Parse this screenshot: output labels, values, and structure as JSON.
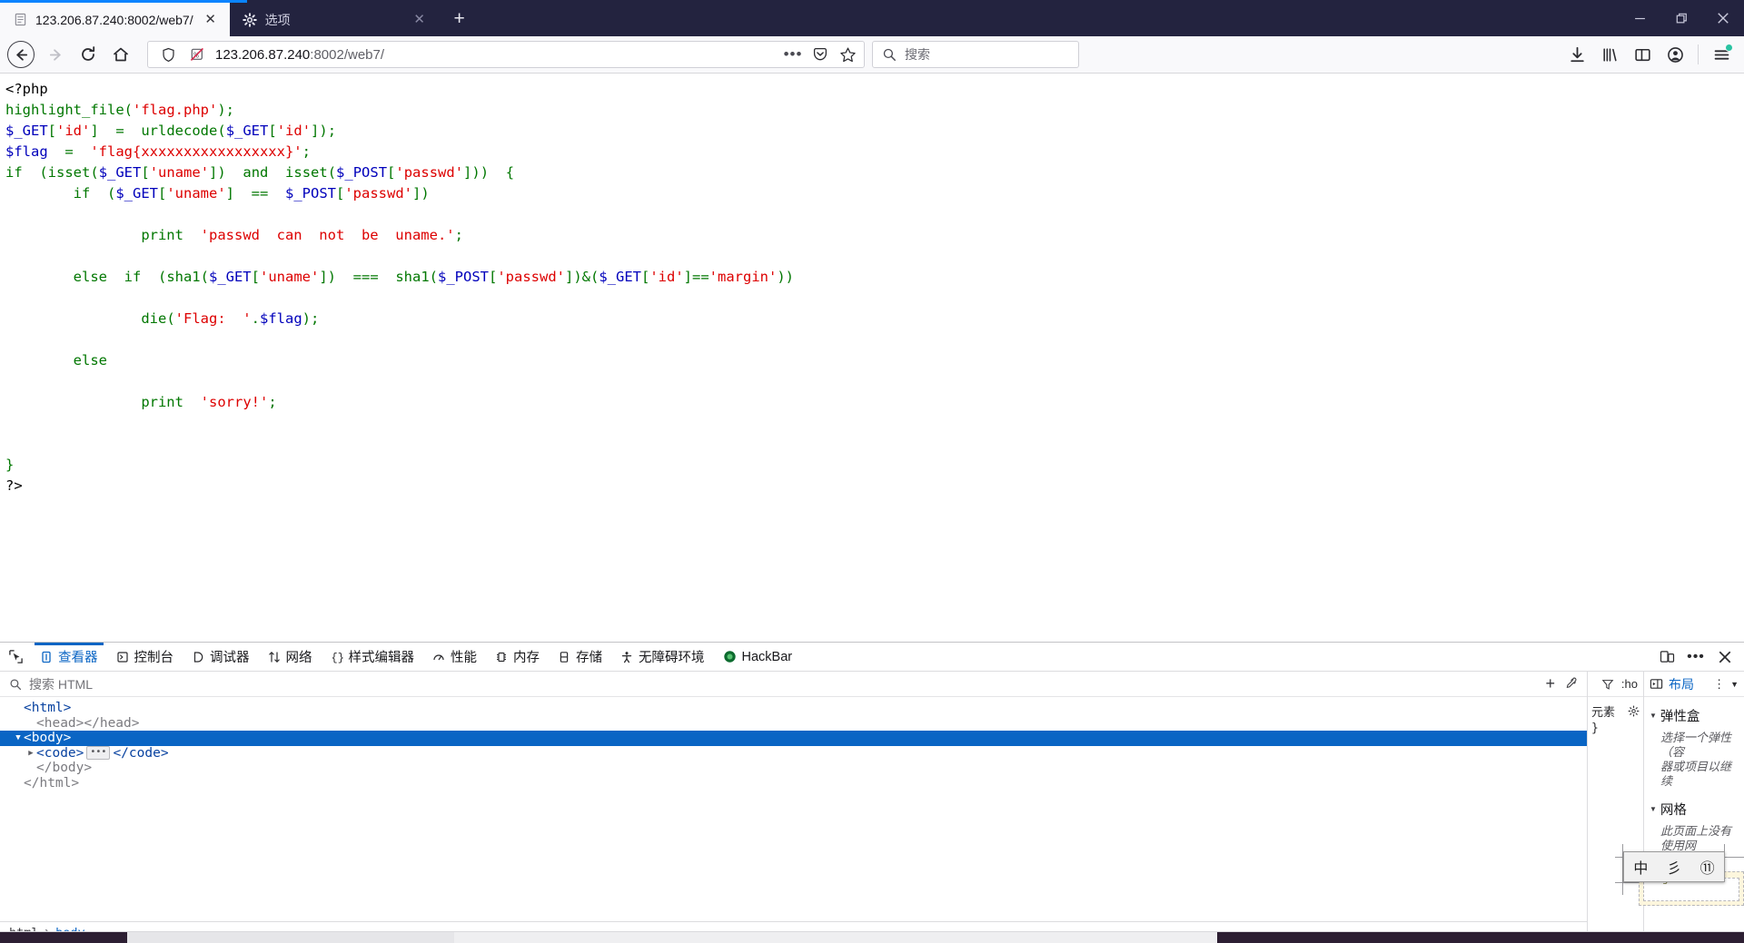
{
  "window": {
    "controls": {
      "minimize": "—",
      "maximize": "❐",
      "close": "✕"
    }
  },
  "tabs": [
    {
      "title": "123.206.87.240:8002/web7/",
      "favicon": "page-icon",
      "close_label": "✕",
      "active": true
    },
    {
      "title": "选项",
      "favicon": "gear-icon",
      "close_label": "✕",
      "active": false
    }
  ],
  "newtab_label": "+",
  "toolbar": {
    "back_label": "←",
    "forward_label": "→",
    "reload_label": "⟳",
    "home_label": "⌂",
    "url_host": "123.206.87.240",
    "url_path": ":8002/web7/",
    "shield_icon": "shield-icon",
    "tracking_blocked_icon": "tracking-protection-off-icon",
    "page_actions_label": "•••",
    "pocket_icon": "pocket-icon",
    "bookmark_icon": "star-icon",
    "search_placeholder": "搜索",
    "search_icon": "search-icon",
    "downloads_icon": "download-icon",
    "library_icon": "library-icon",
    "sidebar_icon": "sidebar-icon",
    "account_icon": "account-icon",
    "menu_icon": "hamburger-menu-icon"
  },
  "page": {
    "code_lines": [
      [
        {
          "t": "<?php",
          "c": "html"
        }
      ],
      [
        {
          "t": "highlight_file",
          "c": "def"
        },
        {
          "t": "(",
          "c": "kw"
        },
        {
          "t": "'flag.php'",
          "c": "str"
        },
        {
          "t": ");",
          "c": "kw"
        }
      ],
      [
        {
          "t": "$_GET",
          "c": "var"
        },
        {
          "t": "[",
          "c": "kw"
        },
        {
          "t": "'id'",
          "c": "str"
        },
        {
          "t": "]  =  ",
          "c": "kw"
        },
        {
          "t": "urldecode",
          "c": "def"
        },
        {
          "t": "(",
          "c": "kw"
        },
        {
          "t": "$_GET",
          "c": "var"
        },
        {
          "t": "[",
          "c": "kw"
        },
        {
          "t": "'id'",
          "c": "str"
        },
        {
          "t": "]);",
          "c": "kw"
        }
      ],
      [
        {
          "t": "$flag",
          "c": "var"
        },
        {
          "t": "  =  ",
          "c": "kw"
        },
        {
          "t": "'flag{xxxxxxxxxxxxxxxxx}'",
          "c": "str"
        },
        {
          "t": ";",
          "c": "kw"
        }
      ],
      [
        {
          "t": "if",
          "c": "kw"
        },
        {
          "t": "  (",
          "c": "kw"
        },
        {
          "t": "isset",
          "c": "def"
        },
        {
          "t": "(",
          "c": "kw"
        },
        {
          "t": "$_GET",
          "c": "var"
        },
        {
          "t": "[",
          "c": "kw"
        },
        {
          "t": "'uname'",
          "c": "str"
        },
        {
          "t": "])  ",
          "c": "kw"
        },
        {
          "t": "and",
          "c": "kw"
        },
        {
          "t": "  ",
          "c": "kw"
        },
        {
          "t": "isset",
          "c": "def"
        },
        {
          "t": "(",
          "c": "kw"
        },
        {
          "t": "$_POST",
          "c": "var"
        },
        {
          "t": "[",
          "c": "kw"
        },
        {
          "t": "'passwd'",
          "c": "str"
        },
        {
          "t": "]))  {",
          "c": "kw"
        }
      ],
      [
        {
          "t": "        if  (",
          "c": "kw"
        },
        {
          "t": "$_GET",
          "c": "var"
        },
        {
          "t": "[",
          "c": "kw"
        },
        {
          "t": "'uname'",
          "c": "str"
        },
        {
          "t": "]  ==  ",
          "c": "kw"
        },
        {
          "t": "$_POST",
          "c": "var"
        },
        {
          "t": "[",
          "c": "kw"
        },
        {
          "t": "'passwd'",
          "c": "str"
        },
        {
          "t": "])",
          "c": "kw"
        }
      ],
      [
        {
          "t": "",
          "c": "kw"
        }
      ],
      [
        {
          "t": "                ",
          "c": "kw"
        },
        {
          "t": "print",
          "c": "kw"
        },
        {
          "t": "  ",
          "c": "kw"
        },
        {
          "t": "'passwd  can  not  be  uname.'",
          "c": "str"
        },
        {
          "t": ";",
          "c": "kw"
        }
      ],
      [
        {
          "t": "",
          "c": "kw"
        }
      ],
      [
        {
          "t": "        else  if  (",
          "c": "kw"
        },
        {
          "t": "sha1",
          "c": "def"
        },
        {
          "t": "(",
          "c": "kw"
        },
        {
          "t": "$_GET",
          "c": "var"
        },
        {
          "t": "[",
          "c": "kw"
        },
        {
          "t": "'uname'",
          "c": "str"
        },
        {
          "t": "])  ===  ",
          "c": "kw"
        },
        {
          "t": "sha1",
          "c": "def"
        },
        {
          "t": "(",
          "c": "kw"
        },
        {
          "t": "$_POST",
          "c": "var"
        },
        {
          "t": "[",
          "c": "kw"
        },
        {
          "t": "'passwd'",
          "c": "str"
        },
        {
          "t": "])&(",
          "c": "kw"
        },
        {
          "t": "$_GET",
          "c": "var"
        },
        {
          "t": "[",
          "c": "kw"
        },
        {
          "t": "'id'",
          "c": "str"
        },
        {
          "t": "]==",
          "c": "kw"
        },
        {
          "t": "'margin'",
          "c": "str"
        },
        {
          "t": "))",
          "c": "kw"
        }
      ],
      [
        {
          "t": "",
          "c": "kw"
        }
      ],
      [
        {
          "t": "                ",
          "c": "kw"
        },
        {
          "t": "die",
          "c": "def"
        },
        {
          "t": "(",
          "c": "kw"
        },
        {
          "t": "'Flag:  '",
          "c": "str"
        },
        {
          "t": ".",
          "c": "kw"
        },
        {
          "t": "$flag",
          "c": "var"
        },
        {
          "t": ");",
          "c": "kw"
        }
      ],
      [
        {
          "t": "",
          "c": "kw"
        }
      ],
      [
        {
          "t": "        else",
          "c": "kw"
        }
      ],
      [
        {
          "t": "",
          "c": "kw"
        }
      ],
      [
        {
          "t": "                ",
          "c": "kw"
        },
        {
          "t": "print",
          "c": "kw"
        },
        {
          "t": "  ",
          "c": "kw"
        },
        {
          "t": "'sorry!'",
          "c": "str"
        },
        {
          "t": ";",
          "c": "kw"
        }
      ],
      [
        {
          "t": "",
          "c": "kw"
        }
      ],
      [
        {
          "t": "",
          "c": "kw"
        }
      ],
      [
        {
          "t": "}",
          "c": "kw"
        }
      ],
      [
        {
          "t": "?>",
          "c": "html"
        }
      ]
    ]
  },
  "devtools": {
    "picker_icon": "element-picker-icon",
    "tabs": [
      {
        "label": "查看器",
        "icon": "inspector-icon",
        "active": true
      },
      {
        "label": "控制台",
        "icon": "console-icon",
        "active": false
      },
      {
        "label": "调试器",
        "icon": "debugger-icon",
        "active": false
      },
      {
        "label": "网络",
        "icon": "network-icon",
        "active": false
      },
      {
        "label": "样式编辑器",
        "icon": "style-editor-icon",
        "active": false
      },
      {
        "label": "性能",
        "icon": "performance-icon",
        "active": false
      },
      {
        "label": "内存",
        "icon": "memory-icon",
        "active": false
      },
      {
        "label": "存储",
        "icon": "storage-icon",
        "active": false
      },
      {
        "label": "无障碍环境",
        "icon": "accessibility-icon",
        "active": false
      },
      {
        "label": "HackBar",
        "icon": "hackbar-icon",
        "active": false
      }
    ],
    "right_buttons": [
      {
        "name": "responsive-design-mode-button",
        "label": "❐"
      },
      {
        "name": "devtools-more-options-button",
        "label": "•••"
      },
      {
        "name": "devtools-close-button",
        "label": "✕"
      }
    ],
    "markup": {
      "search_placeholder": "搜索 HTML",
      "add_node_label": "+",
      "eyedropper_label": "eyedropper",
      "rows": [
        {
          "indent": 0,
          "twisty": "",
          "text": "<html>",
          "selected": false
        },
        {
          "indent": 1,
          "twisty": "",
          "text": "<head></head>",
          "selected": false
        },
        {
          "indent": 0,
          "twisty": "▼",
          "text": "<body>",
          "selected": true
        },
        {
          "indent": 1,
          "twisty": "▶",
          "text": "<code>",
          "badge": "•••",
          "tail": "</code>",
          "selected": false
        },
        {
          "indent": 1,
          "twisty": "",
          "text": "</body>",
          "selected": false
        },
        {
          "indent": 0,
          "twisty": "",
          "text": "</html>",
          "selected": false
        }
      ],
      "breadcrumbs": [
        {
          "label": "html",
          "active": false
        },
        {
          "label": "body",
          "active": true
        }
      ],
      "breadcrumb_separator": "❯"
    },
    "rules": {
      "filter_icon": "filter-icon",
      "hover_label": ":ho",
      "element_label": "元素",
      "settings_icon": "gear-icon",
      "brace": "}"
    },
    "layout": {
      "split_icon": "split-view-icon",
      "tab_label": "布局",
      "options_label": "⋮",
      "caret": "▾",
      "flexbox": {
        "title": "弹性盒",
        "note": "选择一个弹性（容\n器或项目以继续"
      },
      "grid": {
        "title": "网格",
        "note": "此页面上没有使用网\n格"
      },
      "boxmodel": {
        "label": "margin"
      }
    }
  },
  "ime": {
    "candidates": [
      "中",
      "彡",
      "⑪"
    ]
  }
}
